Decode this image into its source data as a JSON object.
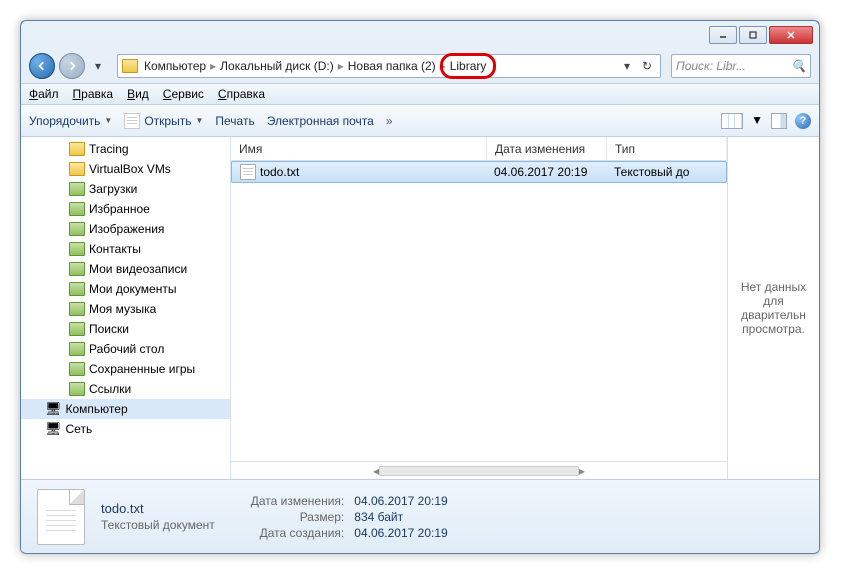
{
  "titlebar": {},
  "breadcrumb": {
    "items": [
      "Компьютер",
      "Локальный диск (D:)",
      "Новая папка (2)",
      "Library"
    ],
    "highlighted_index": 3
  },
  "search": {
    "placeholder": "Поиск: Libr..."
  },
  "menubar": {
    "items": [
      "Файл",
      "Правка",
      "Вид",
      "Сервис",
      "Справка"
    ]
  },
  "toolbar": {
    "organize": "Упорядочить",
    "open": "Открыть",
    "print": "Печать",
    "email": "Электронная почта"
  },
  "sidebar": {
    "items": [
      {
        "label": "Tracing",
        "icon": "folder",
        "lvl": 1
      },
      {
        "label": "VirtualBox VMs",
        "icon": "folder",
        "lvl": 1
      },
      {
        "label": "Загрузки",
        "icon": "special",
        "lvl": 1
      },
      {
        "label": "Избранное",
        "icon": "special",
        "lvl": 1
      },
      {
        "label": "Изображения",
        "icon": "special",
        "lvl": 1
      },
      {
        "label": "Контакты",
        "icon": "special",
        "lvl": 1
      },
      {
        "label": "Мои видеозаписи",
        "icon": "special",
        "lvl": 1
      },
      {
        "label": "Мои документы",
        "icon": "special",
        "lvl": 1
      },
      {
        "label": "Моя музыка",
        "icon": "special",
        "lvl": 1
      },
      {
        "label": "Поиски",
        "icon": "special",
        "lvl": 1
      },
      {
        "label": "Рабочий стол",
        "icon": "special",
        "lvl": 1
      },
      {
        "label": "Сохраненные игры",
        "icon": "special",
        "lvl": 1
      },
      {
        "label": "Ссылки",
        "icon": "special",
        "lvl": 1
      },
      {
        "label": "Компьютер",
        "icon": "comp",
        "lvl": 0,
        "sel": true
      },
      {
        "label": "Сеть",
        "icon": "comp",
        "lvl": 0
      }
    ]
  },
  "columns": {
    "name": "Имя",
    "date": "Дата изменения",
    "type": "Тип"
  },
  "files": [
    {
      "name": "todo.txt",
      "date": "04.06.2017 20:19",
      "type": "Текстовый до",
      "selected": true
    }
  ],
  "preview": {
    "text": "Нет данных для дварительн просмотра."
  },
  "details": {
    "name": "todo.txt",
    "type": "Текстовый документ",
    "props": {
      "date_label": "Дата изменения:",
      "date": "04.06.2017 20:19",
      "size_label": "Размер:",
      "size": "834 байт",
      "created_label": "Дата создания:",
      "created": "04.06.2017 20:19"
    }
  }
}
